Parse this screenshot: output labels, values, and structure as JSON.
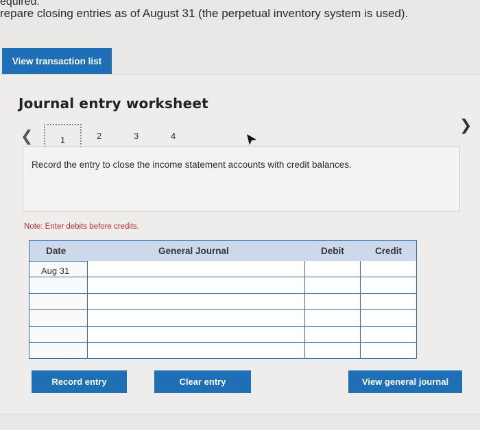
{
  "header": {
    "required_label": "equired:",
    "instructions": "repare closing entries as of August 31 (the perpetual inventory system is used)."
  },
  "view_transaction_button": "View transaction list",
  "worksheet": {
    "title": "Journal entry worksheet",
    "prev_icon": "chevron-left-icon",
    "next_icon": "chevron-right-icon",
    "pages": [
      "1",
      "2",
      "3",
      "4"
    ],
    "current_page": "1",
    "prompt": "Record the entry to close the income statement accounts with credit balances.",
    "note": "Note: Enter debits before credits."
  },
  "table": {
    "headers": {
      "date": "Date",
      "general_journal": "General Journal",
      "debit": "Debit",
      "credit": "Credit"
    },
    "rows": [
      {
        "date": "Aug 31",
        "account": "",
        "debit": "",
        "credit": ""
      },
      {
        "date": "",
        "account": "",
        "debit": "",
        "credit": ""
      },
      {
        "date": "",
        "account": "",
        "debit": "",
        "credit": ""
      },
      {
        "date": "",
        "account": "",
        "debit": "",
        "credit": ""
      },
      {
        "date": "",
        "account": "",
        "debit": "",
        "credit": ""
      },
      {
        "date": "",
        "account": "",
        "debit": "",
        "credit": ""
      }
    ]
  },
  "buttons": {
    "record_entry": "Record entry",
    "clear_entry": "Clear entry",
    "view_general_journal": "View general journal"
  },
  "colors": {
    "primary_button": "#1f6fb6",
    "table_border": "#2d6cb1",
    "table_header_bg": "#cbd9eb",
    "note_text": "#b0302a"
  }
}
